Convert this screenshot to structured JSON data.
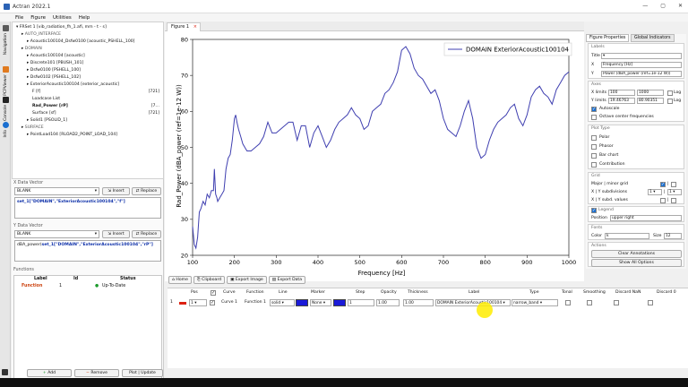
{
  "window": {
    "title": "Actran 2022.1",
    "controls": [
      "—",
      "▢",
      "✕"
    ]
  },
  "menu": [
    "File",
    "Figure",
    "Utilities",
    "Help"
  ],
  "sidetabs": [
    "Navigation",
    "PCPViewer",
    "Console",
    "Info"
  ],
  "tree": {
    "root": "FRSet 1 [vib_radiation_fh_1.afi, mm - t - s]",
    "items": [
      {
        "label": "AUTO_INTERFACE",
        "indent": 1,
        "section": true
      },
      {
        "label": "Acoustic100104_Dsfw0100 [acoustic_PSHELL_100]",
        "indent": 2
      },
      {
        "label": "DOMAIN",
        "indent": 1,
        "section": true
      },
      {
        "label": "Acoustic100104 [acoustic]",
        "indent": 2
      },
      {
        "label": "Discrete101 [PBUSH_101]",
        "indent": 2
      },
      {
        "label": "Dsfw0100 [PSHELL_100]",
        "indent": 2
      },
      {
        "label": "Dsfw0102 [PSHELL_102]",
        "indent": 2
      },
      {
        "label": "ExteriorAcoustic100104 [exterior_acoustic]",
        "indent": 2
      },
      {
        "label": "F [f]",
        "indent": 3,
        "right": "[721]"
      },
      {
        "label": "Loadcase List",
        "indent": 3
      },
      {
        "label": "Rad_Power  [rP]",
        "indent": 3,
        "right": "[7…",
        "bold": true
      },
      {
        "label": "Surface  [sf]",
        "indent": 3,
        "right": "[721]"
      },
      {
        "label": "Solid1 [PSOLID_1]",
        "indent": 2
      },
      {
        "label": "SURFACE",
        "indent": 1,
        "section": true
      },
      {
        "label": "PointLoad104 [RLOAD2_POINT_LOAD_104]",
        "indent": 2
      }
    ]
  },
  "xvec": {
    "title": "X Data Vector",
    "combo": "BLANK",
    "insert": "Insert",
    "replace": "Replace",
    "code": "set_1[\"DOMAIN\",\"ExteriorAcoustic100104\",\"f\"]"
  },
  "yvec": {
    "title": "Y Data Vector",
    "combo": "BLANK",
    "insert": "Insert",
    "replace": "Replace",
    "prefix": "dBA_power(",
    "code": "set_1[\"DOMAIN\",\"ExteriorAcoustic100104\",\"rP\"]"
  },
  "functions": {
    "title": "Functions",
    "headers": [
      "Label",
      "Id",
      "Status"
    ],
    "rows": [
      {
        "label": "Function",
        "id": "1",
        "status": "Up-To-Date"
      }
    ],
    "add": "Add",
    "remove": "Remove",
    "plot": "Plot | Update"
  },
  "figure_tab": "Figure 1",
  "plot_toolbar": [
    "Home",
    "Clipboard",
    "Export Image",
    "Export Data"
  ],
  "chart_data": {
    "type": "line",
    "title": "",
    "xlabel": "Frequency [Hz]",
    "ylabel": "Rad_Power (dBA_power (ref=1e-12 W))",
    "xlim": [
      100,
      1000
    ],
    "ylim": [
      20,
      80
    ],
    "xticks": [
      100,
      200,
      300,
      400,
      500,
      600,
      700,
      800,
      900,
      1000
    ],
    "yticks": [
      20,
      30,
      40,
      50,
      60,
      70,
      80
    ],
    "grid": false,
    "legend": "upper right",
    "series": [
      {
        "name": "DOMAIN ExteriorAcoustic100104",
        "color": "#3f3fb0",
        "x": [
          100,
          104,
          108,
          112,
          116,
          120,
          125,
          130,
          135,
          140,
          145,
          150,
          152,
          155,
          158,
          160,
          165,
          170,
          175,
          180,
          185,
          190,
          195,
          200,
          203,
          206,
          210,
          215,
          220,
          225,
          230,
          240,
          250,
          260,
          270,
          280,
          290,
          300,
          310,
          320,
          330,
          340,
          350,
          360,
          370,
          380,
          390,
          400,
          410,
          420,
          430,
          440,
          450,
          460,
          470,
          480,
          490,
          500,
          510,
          520,
          530,
          540,
          550,
          560,
          570,
          580,
          590,
          600,
          610,
          620,
          630,
          640,
          650,
          660,
          670,
          680,
          690,
          700,
          710,
          720,
          730,
          740,
          750,
          760,
          770,
          780,
          790,
          800,
          810,
          820,
          830,
          840,
          850,
          860,
          870,
          880,
          890,
          900,
          910,
          920,
          930,
          940,
          950,
          960,
          970,
          980,
          990,
          1000
        ],
        "y": [
          28,
          23,
          22,
          25,
          32,
          33,
          35,
          34,
          37,
          36,
          38,
          38,
          44,
          37,
          36,
          35,
          36,
          37,
          38,
          44,
          47,
          48,
          52,
          58,
          59,
          57,
          55,
          53,
          51,
          50,
          49,
          49,
          50,
          51,
          53,
          57,
          54,
          54,
          55,
          56,
          57,
          57,
          52,
          56,
          56,
          50,
          54,
          56,
          53,
          50,
          52,
          55,
          57,
          58,
          59,
          61,
          59,
          58,
          55,
          56,
          60,
          61,
          62,
          65,
          66,
          68,
          71,
          77,
          78,
          76,
          72,
          70,
          69,
          67,
          65,
          66,
          63,
          58,
          55,
          54,
          53,
          56,
          60,
          63,
          58,
          50,
          47,
          48,
          52,
          55,
          57,
          58,
          59,
          61,
          62,
          58,
          56,
          59,
          64,
          66,
          67,
          65,
          64,
          62,
          66,
          68,
          70,
          71
        ]
      }
    ]
  },
  "curvetable": {
    "headers": [
      "Pos",
      "Curve",
      "Function",
      "Line",
      "Marker",
      "Step",
      "Opacity",
      "Thickness",
      "Label",
      "Type",
      "Tonal",
      "Smoothing",
      "Discard NaN",
      "Discard 0"
    ],
    "row": {
      "idx": "1",
      "pos": "1",
      "curve": "Curve 1",
      "function": "Function 1",
      "line": "solid",
      "marker": "None",
      "step": "1",
      "opacity": "1.00",
      "thickness": "1.00",
      "label": "DOMAIN ExteriorAcoustic100104",
      "type": "narrow_band"
    }
  },
  "props": {
    "tabs": [
      "Figure Properties",
      "Global Indicators"
    ],
    "labels": {
      "title": "Labels",
      "title_lbl": "Title",
      "x_lbl": "X",
      "x_val": "Frequency [Hz]",
      "y_lbl": "Y",
      "y_val": "Power (dBA_power (ref=1e-12 W))"
    },
    "axes": {
      "title": "Axes",
      "xlim_lbl": "X limits",
      "xmin": "100",
      "xmax": "1000",
      "ylim_lbl": "Y limits",
      "ymin": "19.46763",
      "ymax": "80.90351",
      "log": "Log",
      "autoscale": "Autoscale",
      "octave": "Octave center frequencies"
    },
    "plottype": {
      "title": "Plot Type",
      "opts": [
        "Polar",
        "Phasor",
        "Bar chart",
        "Contribution"
      ]
    },
    "grid": {
      "title": "Grid",
      "major": "Major | minor grid",
      "sub": "X | Y subdivisions",
      "subval": "1",
      "subd": "X | Y subd. values"
    },
    "legend": {
      "title": "Legend",
      "pos_lbl": "Position",
      "pos_val": "upper right"
    },
    "fonts": {
      "title": "Fonts",
      "color_lbl": "Color",
      "color_val": "k",
      "size_lbl": "Size",
      "size_val": "12"
    },
    "actions": {
      "title": "Actions",
      "clear": "Clear Annotations",
      "show": "Show All Options"
    }
  }
}
